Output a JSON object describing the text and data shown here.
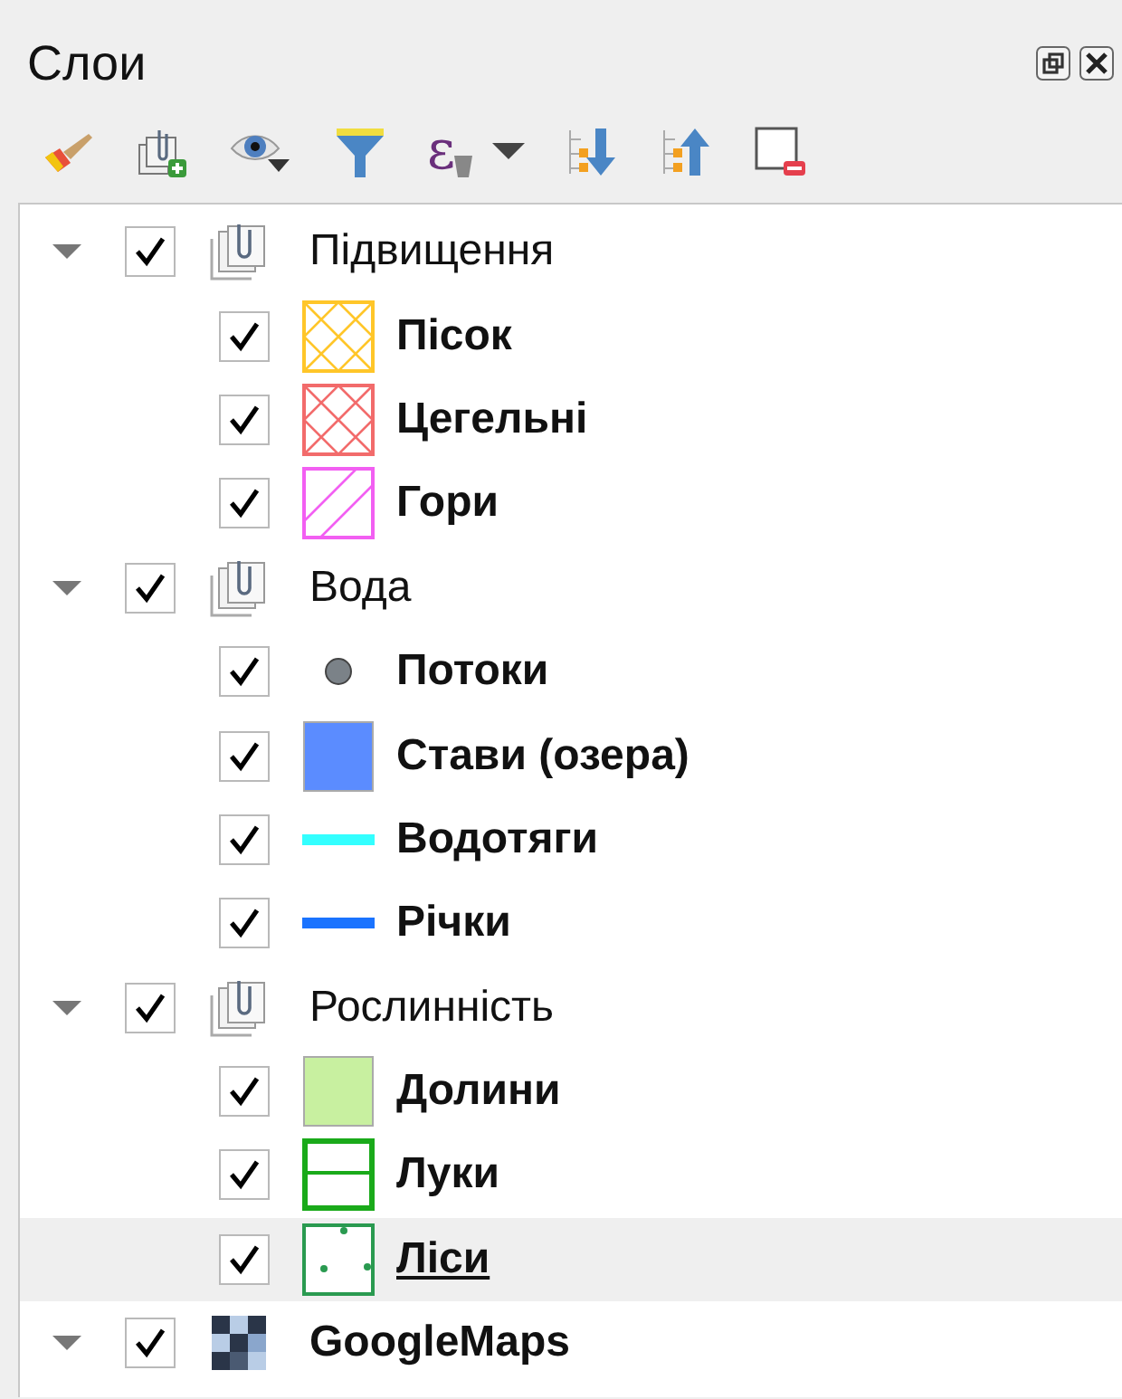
{
  "panel": {
    "title": "Слои"
  },
  "toolbar": {
    "expression_symbol": "ε"
  },
  "tree": [
    {
      "kind": "group",
      "name": "Підвищення",
      "checked": true,
      "expanded": true,
      "selected": false,
      "children": [
        {
          "kind": "layer",
          "name": "Пісок",
          "checked": true,
          "selected": false,
          "symbol": {
            "kind": "hatch-cross",
            "color": "#ffc629"
          }
        },
        {
          "kind": "layer",
          "name": "Цегельні",
          "checked": true,
          "selected": false,
          "symbol": {
            "kind": "hatch-cross",
            "color": "#f26b6b"
          }
        },
        {
          "kind": "layer",
          "name": "Гори",
          "checked": true,
          "selected": false,
          "symbol": {
            "kind": "hatch-diagonal",
            "color": "#f25ff2"
          }
        }
      ]
    },
    {
      "kind": "group",
      "name": "Вода",
      "checked": true,
      "expanded": true,
      "selected": false,
      "children": [
        {
          "kind": "layer",
          "name": "Потоки",
          "checked": true,
          "selected": false,
          "symbol": {
            "kind": "point",
            "color": "#7b8288"
          }
        },
        {
          "kind": "layer",
          "name": "Стави (озера)",
          "checked": true,
          "selected": false,
          "symbol": {
            "kind": "fill",
            "color": "#5b8cff"
          }
        },
        {
          "kind": "layer",
          "name": "Водотяги",
          "checked": true,
          "selected": false,
          "symbol": {
            "kind": "line",
            "color": "#33ffff"
          }
        },
        {
          "kind": "layer",
          "name": "Річки",
          "checked": true,
          "selected": false,
          "symbol": {
            "kind": "line",
            "color": "#1a73ff"
          }
        }
      ]
    },
    {
      "kind": "group",
      "name": "Рослинність",
      "checked": true,
      "expanded": true,
      "selected": false,
      "children": [
        {
          "kind": "layer",
          "name": "Долини",
          "checked": true,
          "selected": false,
          "symbol": {
            "kind": "fill",
            "color": "#c8f0a0"
          }
        },
        {
          "kind": "layer",
          "name": "Луки",
          "checked": true,
          "selected": false,
          "symbol": {
            "kind": "line-pattern",
            "color": "#1aaa1a"
          }
        },
        {
          "kind": "layer",
          "name": "Ліси",
          "checked": true,
          "selected": true,
          "symbol": {
            "kind": "point-pattern",
            "color": "#2a9a50"
          }
        }
      ]
    },
    {
      "kind": "raster",
      "name": "GoogleMaps",
      "checked": true,
      "expanded": true,
      "selected": false
    }
  ]
}
